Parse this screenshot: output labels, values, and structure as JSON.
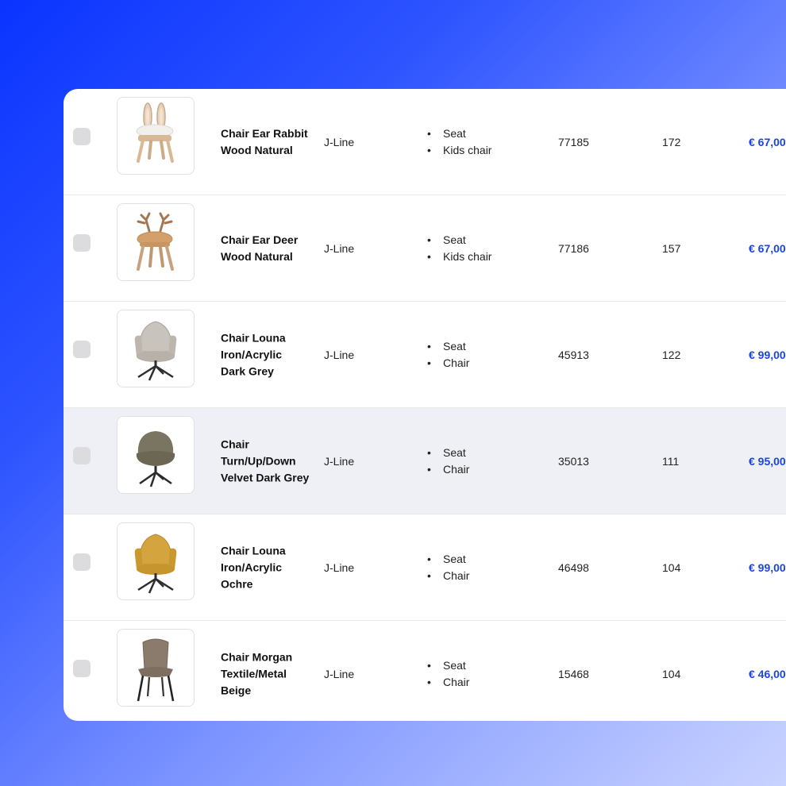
{
  "products": [
    {
      "name": "Chair Ear Rabbit Wood Natural",
      "brand": "J-Line",
      "tags": [
        "Seat",
        "Kids chair"
      ],
      "code": "77185",
      "stock": "172",
      "price": "€ 67,00",
      "image": "rabbit-chair",
      "selected": false
    },
    {
      "name": "Chair Ear Deer Wood Natural",
      "brand": "J-Line",
      "tags": [
        "Seat",
        "Kids chair"
      ],
      "code": "77186",
      "stock": "157",
      "price": "€ 67,00",
      "image": "deer-chair",
      "selected": false
    },
    {
      "name": "Chair Louna Iron/Acrylic Dark Grey",
      "brand": "J-Line",
      "tags": [
        "Seat",
        "Chair"
      ],
      "code": "45913",
      "stock": "122",
      "price": "€ 99,00",
      "image": "armchair-grey",
      "selected": false
    },
    {
      "name": "Chair Turn/Up/Down Velvet Dark Grey",
      "brand": "J-Line",
      "tags": [
        "Seat",
        "Chair"
      ],
      "code": "35013",
      "stock": "111",
      "price": "€ 95,00",
      "image": "tub-chair-olive",
      "selected": false,
      "hovered": true
    },
    {
      "name": "Chair Louna Iron/Acrylic Ochre",
      "brand": "J-Line",
      "tags": [
        "Seat",
        "Chair"
      ],
      "code": "46498",
      "stock": "104",
      "price": "€ 99,00",
      "image": "armchair-ochre",
      "selected": false
    },
    {
      "name": "Chair Morgan Textile/Metal Beige",
      "brand": "J-Line",
      "tags": [
        "Seat",
        "Chair"
      ],
      "code": "15468",
      "stock": "104",
      "price": "€ 46,00",
      "image": "dining-chair-beige",
      "selected": false
    }
  ],
  "colors": {
    "accent": "#1a44e6",
    "highlight_row": "#eff0f5"
  }
}
